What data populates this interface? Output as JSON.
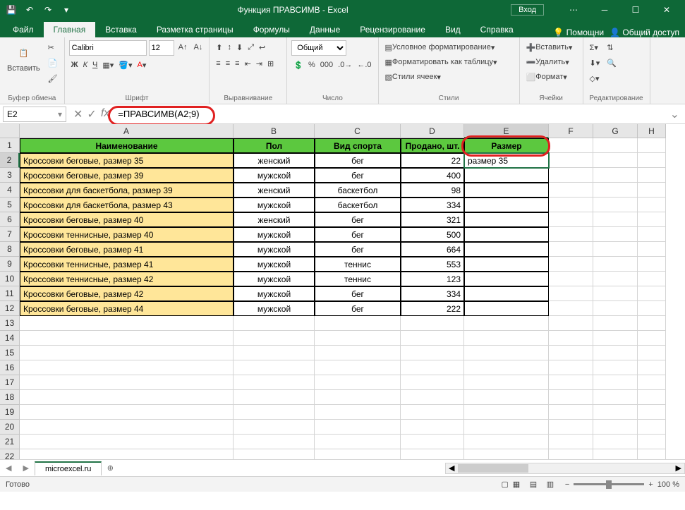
{
  "title": "Функция ПРАВСИМВ - Excel",
  "login": "Вход",
  "tabs": [
    "Файл",
    "Главная",
    "Вставка",
    "Разметка страницы",
    "Формулы",
    "Данные",
    "Рецензирование",
    "Вид",
    "Справка"
  ],
  "active_tab": "Главная",
  "helper": {
    "tell": "Помощни",
    "share": "Общий доступ"
  },
  "ribbon": {
    "clipboard": {
      "paste": "Вставить",
      "label": "Буфер обмена"
    },
    "font": {
      "name": "Calibri",
      "size": "12",
      "bold": "Ж",
      "italic": "К",
      "underline": "Ч",
      "label": "Шрифт"
    },
    "alignment": {
      "label": "Выравнивание"
    },
    "number": {
      "format": "Общий",
      "label": "Число"
    },
    "styles": {
      "cond": "Условное форматирование",
      "table": "Форматировать как таблицу",
      "cell": "Стили ячеек",
      "label": "Стили"
    },
    "cells": {
      "insert": "Вставить",
      "delete": "Удалить",
      "format": "Формат",
      "label": "Ячейки"
    },
    "editing": {
      "label": "Редактирование"
    }
  },
  "formula_bar": {
    "cell_ref": "E2",
    "formula": "=ПРАВСИМВ(A2;9)",
    "fx": "fx"
  },
  "columns": [
    "A",
    "B",
    "C",
    "D",
    "E",
    "F",
    "G",
    "H"
  ],
  "headers": [
    "Наименование",
    "Пол",
    "Вид спорта",
    "Продано, шт.",
    "Размер"
  ],
  "rows": [
    {
      "a": "Кроссовки беговые, размер 35",
      "b": "женский",
      "c": "бег",
      "d": "22",
      "e": "размер 35"
    },
    {
      "a": "Кроссовки беговые, размер 39",
      "b": "мужской",
      "c": "бег",
      "d": "400",
      "e": ""
    },
    {
      "a": "Кроссовки для баскетбола, размер 39",
      "b": "женский",
      "c": "баскетбол",
      "d": "98",
      "e": ""
    },
    {
      "a": "Кроссовки для баскетбола, размер 43",
      "b": "мужской",
      "c": "баскетбол",
      "d": "334",
      "e": ""
    },
    {
      "a": "Кроссовки беговые, размер 40",
      "b": "женский",
      "c": "бег",
      "d": "321",
      "e": ""
    },
    {
      "a": "Кроссовки теннисные, размер 40",
      "b": "мужской",
      "c": "бег",
      "d": "500",
      "e": ""
    },
    {
      "a": "Кроссовки беговые, размер 41",
      "b": "мужской",
      "c": "бег",
      "d": "664",
      "e": ""
    },
    {
      "a": "Кроссовки теннисные, размер 41",
      "b": "мужской",
      "c": "теннис",
      "d": "553",
      "e": ""
    },
    {
      "a": "Кроссовки теннисные, размер 42",
      "b": "мужской",
      "c": "теннис",
      "d": "123",
      "e": ""
    },
    {
      "a": "Кроссовки беговые, размер 42",
      "b": "мужской",
      "c": "бег",
      "d": "334",
      "e": ""
    },
    {
      "a": "Кроссовки беговые, размер 44",
      "b": "мужской",
      "c": "бег",
      "d": "222",
      "e": ""
    }
  ],
  "sheet_tab": "microexcel.ru",
  "status": "Готово",
  "zoom": "100 %"
}
